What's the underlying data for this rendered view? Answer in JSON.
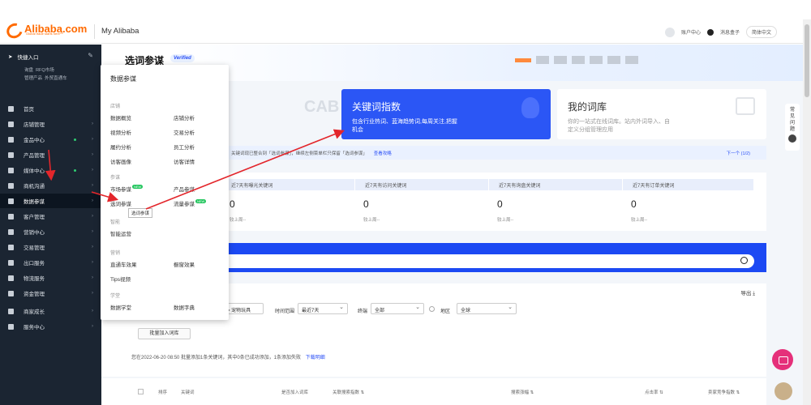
{
  "header": {
    "logo_text": "Alibaba.com",
    "logo_tagline": "Global trade starts here™",
    "app_title": "My Alibaba",
    "account_label": "账户中心",
    "message_label": "消息盒子",
    "language_label": "简体中文"
  },
  "sidebar": {
    "quick_entry": "快捷入口",
    "quick_links": [
      "询盘",
      "RFQ市场",
      "管理产品",
      "外贸直通车"
    ],
    "items": [
      {
        "label": "首页",
        "icon": "home-icon",
        "dot": false,
        "arrow": false
      },
      {
        "label": "店铺管理",
        "icon": "store-icon",
        "dot": false,
        "arrow": true
      },
      {
        "label": "金品中心",
        "icon": "shield-icon",
        "dot": true,
        "arrow": true
      },
      {
        "label": "产品管理",
        "icon": "grid-icon",
        "dot": false,
        "arrow": true
      },
      {
        "label": "媒体中心",
        "icon": "media-icon",
        "dot": true,
        "arrow": true
      },
      {
        "label": "商机沟通",
        "icon": "chat-icon",
        "dot": false,
        "arrow": true
      },
      {
        "label": "数据参谋",
        "icon": "bar-chart-icon",
        "dot": false,
        "arrow": true,
        "active": true
      },
      {
        "label": "客户管理",
        "icon": "user-icon",
        "dot": false,
        "arrow": true
      },
      {
        "label": "营销中心",
        "icon": "marketing-icon",
        "dot": false,
        "arrow": true
      },
      {
        "label": "交易管理",
        "icon": "trade-icon",
        "dot": false,
        "arrow": true
      },
      {
        "label": "出口服务",
        "icon": "export-icon",
        "dot": false,
        "arrow": true
      },
      {
        "label": "物流服务",
        "icon": "logistics-icon",
        "dot": false,
        "arrow": true
      },
      {
        "label": "资金管理",
        "icon": "bank-icon",
        "dot": false,
        "arrow": true
      },
      {
        "label": "商家成长",
        "icon": "heart-icon",
        "dot": false,
        "arrow": true
      },
      {
        "label": "服务中心",
        "icon": "service-icon",
        "dot": false,
        "arrow": true
      }
    ]
  },
  "page": {
    "title": "选词参谋",
    "verified": "Verified"
  },
  "cards": {
    "keyword_index": {
      "title": "关键词指数",
      "desc": "包含行业热词、蓝海趋势词,每周关注,把握机会"
    },
    "my_words": {
      "title": "我的词库",
      "desc": "你的一站式在线词库。站内外词导入、自定义分组管理应用"
    }
  },
  "notice": {
    "text": "关键词现已整合到「选词参谋」，继续左侧菜单栏只保留「选词参谋」",
    "link": "查看攻略",
    "next": "下一个 (1/2)"
  },
  "stats": [
    {
      "label": "近7天有曝光关键词",
      "value": "0",
      "sub": "较上周--"
    },
    {
      "label": "近7天有访问关键词",
      "value": "0",
      "sub": "较上周--"
    },
    {
      "label": "近7天有询盘关键词",
      "value": "0",
      "sub": "较上周--"
    },
    {
      "label": "近7天有订单关键词",
      "value": "0",
      "sub": "较上周--"
    }
  ],
  "filters": {
    "export": "导出 ⤓",
    "category_value": "> 宠物玩具",
    "time_label": "时间范围",
    "time_value": "最近7天",
    "terminal_label": "终端",
    "terminal_value": "全部",
    "region_label": "地区",
    "region_value": "全球",
    "batch_button": "批量加入词库",
    "info": "您在2022-06-20 08:50 批量添加1条关键词，其中0条已成功添加，1条添加失败",
    "info_link": "下载明细"
  },
  "table": {
    "headers": [
      "排序",
      "关键词",
      "是否加入词库",
      "关联搜索指数 ⇅",
      "搜索涨幅 ⇅",
      "点击率 ⇅",
      "卖家竞争指数 ⇅"
    ]
  },
  "right_rail": {
    "label": "常见问题"
  },
  "menu": {
    "title": "数据参谋",
    "groups": [
      {
        "name": "店铺",
        "items": [
          "数据概览",
          "店铺分析",
          "视频分析",
          "交易分析",
          "履约分析",
          "员工分析",
          "访客画像",
          "访客详情"
        ]
      },
      {
        "name": "参谋",
        "items": [
          "市场参谋",
          "产品参谋",
          "选词参谋",
          "流量参谋"
        ],
        "new": [
          "市场参谋",
          "流量参谋"
        ]
      },
      {
        "name": "智能",
        "items": [
          "智能运营"
        ]
      },
      {
        "name": "营销",
        "items": [
          "直通车效果",
          "橱窗效果",
          "Tips视频"
        ]
      },
      {
        "name": "学堂",
        "items": [
          "数据学堂",
          "数据字典"
        ]
      }
    ],
    "new_badge": "NEW",
    "tooltip": "选词参谋"
  },
  "colors": {
    "brand": "#ff6a00",
    "sidebar_bg": "#1b2532",
    "primary_blue": "#2b56f5",
    "annotation_red": "#e3262b"
  }
}
